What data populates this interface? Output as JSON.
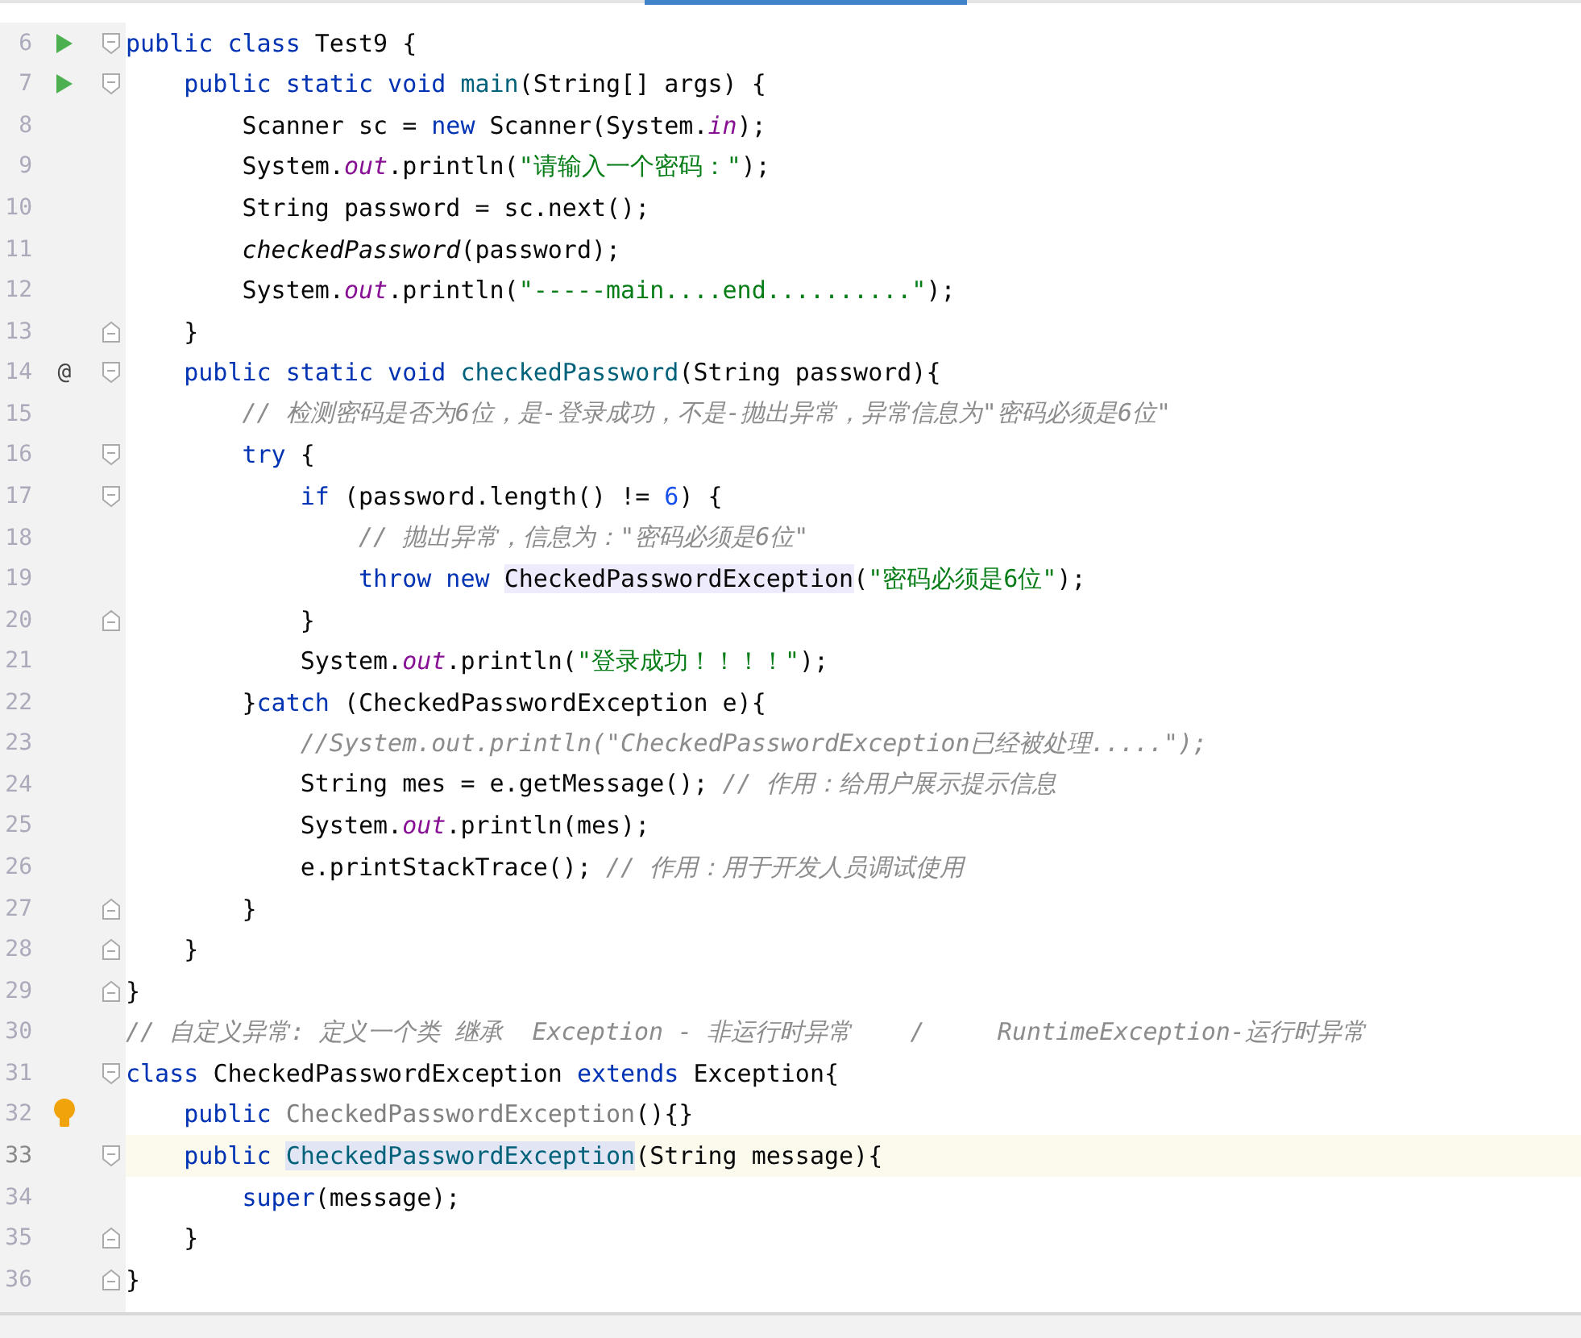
{
  "editor": {
    "lines": [
      {
        "number": "6",
        "marker": {
          "kind": "run"
        },
        "fold": {
          "kind": "open"
        },
        "current": false,
        "tokens": [
          {
            "t": "public class ",
            "kind": "kw"
          },
          {
            "t": "Test9 {",
            "kind": "plain"
          }
        ]
      },
      {
        "number": "7",
        "marker": {
          "kind": "run"
        },
        "fold": {
          "kind": "open"
        },
        "current": false,
        "tokens": [
          {
            "t": "    public static void ",
            "kind": "kw"
          },
          {
            "t": "main",
            "kind": "decl"
          },
          {
            "t": "(String[] args) {",
            "kind": "plain"
          }
        ]
      },
      {
        "number": "8",
        "current": false,
        "tokens": [
          {
            "t": "        Scanner sc = ",
            "kind": "plain"
          },
          {
            "t": "new ",
            "kind": "kw"
          },
          {
            "t": "Scanner(System.",
            "kind": "plain"
          },
          {
            "t": "in",
            "kind": "field"
          },
          {
            "t": ");",
            "kind": "plain"
          }
        ]
      },
      {
        "number": "9",
        "current": false,
        "tokens": [
          {
            "t": "        System.",
            "kind": "plain"
          },
          {
            "t": "out",
            "kind": "field"
          },
          {
            "t": ".println(",
            "kind": "plain"
          },
          {
            "t": "\"请输入一个密码：\"",
            "kind": "str"
          },
          {
            "t": ");",
            "kind": "plain"
          }
        ]
      },
      {
        "number": "10",
        "current": false,
        "tokens": [
          {
            "t": "        String password = sc.next();",
            "kind": "plain"
          }
        ]
      },
      {
        "number": "11",
        "current": false,
        "tokens": [
          {
            "t": "        checkedPassword",
            "kind": "italic"
          },
          {
            "t": "(password);",
            "kind": "plain"
          }
        ]
      },
      {
        "number": "12",
        "current": false,
        "tokens": [
          {
            "t": "        System.",
            "kind": "plain"
          },
          {
            "t": "out",
            "kind": "field"
          },
          {
            "t": ".println(",
            "kind": "plain"
          },
          {
            "t": "\"-----main....end..........\"",
            "kind": "str"
          },
          {
            "t": ");",
            "kind": "plain"
          }
        ]
      },
      {
        "number": "13",
        "fold": {
          "kind": "close"
        },
        "current": false,
        "tokens": [
          {
            "t": "    }",
            "kind": "plain"
          }
        ]
      },
      {
        "number": "14",
        "marker": {
          "kind": "override",
          "text": "@"
        },
        "fold": {
          "kind": "open"
        },
        "current": false,
        "tokens": [
          {
            "t": "    public static void ",
            "kind": "kw"
          },
          {
            "t": "checkedPassword",
            "kind": "decl"
          },
          {
            "t": "(String password){",
            "kind": "plain"
          }
        ]
      },
      {
        "number": "15",
        "current": false,
        "tokens": [
          {
            "t": "        // 检测密码是否为6位，是-登录成功，不是-抛出异常，异常信息为\"密码必须是6位\"",
            "kind": "comment"
          }
        ]
      },
      {
        "number": "16",
        "fold": {
          "kind": "open"
        },
        "current": false,
        "tokens": [
          {
            "t": "        try ",
            "kind": "kw"
          },
          {
            "t": "{",
            "kind": "plain"
          }
        ]
      },
      {
        "number": "17",
        "fold": {
          "kind": "open"
        },
        "current": false,
        "tokens": [
          {
            "t": "            if ",
            "kind": "kw"
          },
          {
            "t": "(password.length() != ",
            "kind": "plain"
          },
          {
            "t": "6",
            "kind": "num"
          },
          {
            "t": ") {",
            "kind": "plain"
          }
        ]
      },
      {
        "number": "18",
        "current": false,
        "tokens": [
          {
            "t": "                // 抛出异常，信息为：\"密码必须是6位\"",
            "kind": "comment"
          }
        ]
      },
      {
        "number": "19",
        "current": false,
        "tokens": [
          {
            "t": "                throw new ",
            "kind": "kw"
          },
          {
            "t": "CheckedPasswordException",
            "kind": "ref"
          },
          {
            "t": "(",
            "kind": "plain"
          },
          {
            "t": "\"密码必须是6位\"",
            "kind": "str"
          },
          {
            "t": ");",
            "kind": "plain"
          }
        ]
      },
      {
        "number": "20",
        "fold": {
          "kind": "close"
        },
        "current": false,
        "tokens": [
          {
            "t": "            }",
            "kind": "plain"
          }
        ]
      },
      {
        "number": "21",
        "current": false,
        "tokens": [
          {
            "t": "            System.",
            "kind": "plain"
          },
          {
            "t": "out",
            "kind": "field"
          },
          {
            "t": ".println(",
            "kind": "plain"
          },
          {
            "t": "\"登录成功！！！！\"",
            "kind": "str"
          },
          {
            "t": ");",
            "kind": "plain"
          }
        ]
      },
      {
        "number": "22",
        "current": false,
        "tokens": [
          {
            "t": "        }",
            "kind": "plain"
          },
          {
            "t": "catch ",
            "kind": "kw"
          },
          {
            "t": "(CheckedPasswordException e){",
            "kind": "plain"
          }
        ]
      },
      {
        "number": "23",
        "current": false,
        "tokens": [
          {
            "t": "            //System.out.println(\"CheckedPasswordException已经被处理.....\");",
            "kind": "comment"
          }
        ]
      },
      {
        "number": "24",
        "current": false,
        "tokens": [
          {
            "t": "            String mes = e.getMessage(); ",
            "kind": "plain"
          },
          {
            "t": "// 作用：给用户展示提示信息",
            "kind": "comment"
          }
        ]
      },
      {
        "number": "25",
        "current": false,
        "tokens": [
          {
            "t": "            System.",
            "kind": "plain"
          },
          {
            "t": "out",
            "kind": "field"
          },
          {
            "t": ".println(mes);",
            "kind": "plain"
          }
        ]
      },
      {
        "number": "26",
        "current": false,
        "tokens": [
          {
            "t": "            e.printStackTrace(); ",
            "kind": "plain"
          },
          {
            "t": "// 作用：用于开发人员调试使用",
            "kind": "comment"
          }
        ]
      },
      {
        "number": "27",
        "fold": {
          "kind": "close"
        },
        "current": false,
        "tokens": [
          {
            "t": "        }",
            "kind": "plain"
          }
        ]
      },
      {
        "number": "28",
        "fold": {
          "kind": "close"
        },
        "current": false,
        "tokens": [
          {
            "t": "    }",
            "kind": "plain"
          }
        ]
      },
      {
        "number": "29",
        "fold": {
          "kind": "close"
        },
        "current": false,
        "tokens": [
          {
            "t": "}",
            "kind": "plain"
          }
        ]
      },
      {
        "number": "30",
        "current": false,
        "tokens": [
          {
            "t": "// 自定义异常: 定义一个类 继承  Exception - 非运行时异常    /     RuntimeException-运行时异常",
            "kind": "comment"
          }
        ]
      },
      {
        "number": "31",
        "fold": {
          "kind": "open"
        },
        "current": false,
        "tokens": [
          {
            "t": "class ",
            "kind": "kw"
          },
          {
            "t": "CheckedPasswordException ",
            "kind": "plain"
          },
          {
            "t": "extends ",
            "kind": "kw"
          },
          {
            "t": "Exception{",
            "kind": "plain"
          }
        ]
      },
      {
        "number": "32",
        "marker": {
          "kind": "bulb"
        },
        "current": false,
        "tokens": [
          {
            "t": "    public ",
            "kind": "kw"
          },
          {
            "t": "CheckedPasswordException",
            "kind": "unused"
          },
          {
            "t": "(){}",
            "kind": "plain"
          }
        ]
      },
      {
        "number": "33",
        "fold": {
          "kind": "open"
        },
        "current": true,
        "tokens": [
          {
            "t": "    public ",
            "kind": "kw"
          },
          {
            "t": "CheckedPasswordException",
            "kind": "declref"
          },
          {
            "t": "(String message){",
            "kind": "plain"
          }
        ]
      },
      {
        "number": "34",
        "current": false,
        "tokens": [
          {
            "t": "        super",
            "kind": "kw"
          },
          {
            "t": "(message);",
            "kind": "plain"
          }
        ]
      },
      {
        "number": "35",
        "fold": {
          "kind": "close"
        },
        "current": false,
        "tokens": [
          {
            "t": "    }",
            "kind": "plain"
          }
        ]
      },
      {
        "number": "36",
        "fold": {
          "kind": "close"
        },
        "current": false,
        "tokens": [
          {
            "t": "}",
            "kind": "plain"
          }
        ]
      }
    ]
  }
}
